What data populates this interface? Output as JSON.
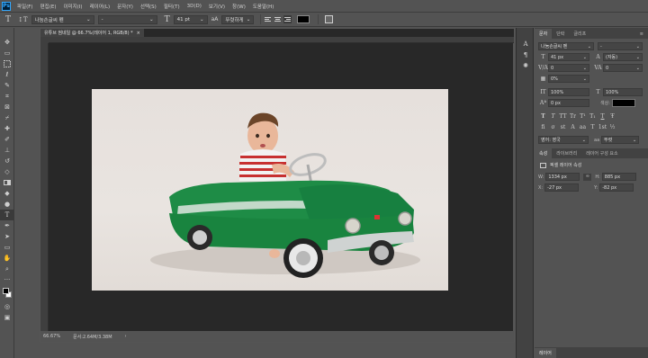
{
  "app": {
    "logo": "Ps"
  },
  "menu": [
    "파일(F)",
    "편집(E)",
    "이미지(I)",
    "레이어(L)",
    "문자(Y)",
    "선택(S)",
    "필터(T)",
    "3D(D)",
    "보기(V)",
    "창(W)",
    "도움말(H)"
  ],
  "options": {
    "font_family": "나눔손글씨 펜",
    "font_style": "-",
    "font_size": "41 pt",
    "aa_icon": "aA",
    "anti_alias": "뚜렷하게",
    "text_color": "#000000"
  },
  "document": {
    "tab_title": "유튜브 썸네일 @ 66.7%(레이어 1, RGB/8) *",
    "zoom": "66.67%",
    "doc_size": "문서:2.64M/3.38M"
  },
  "panel": {
    "tabs": [
      "문자",
      "단락",
      "글리프"
    ],
    "font_family": "나눔손글씨 펜",
    "font_style": "-",
    "font_size": "41 px",
    "leading": "(자동)",
    "kerning": "0",
    "tracking": "0",
    "tsume": "0%",
    "vscale": "100%",
    "hscale": "100%",
    "baseline": "0 px",
    "color_label": "색상:",
    "text_color": "#000000",
    "typo_buttons": [
      "T",
      "T",
      "TT",
      "Tr",
      "T¹",
      "T₁",
      "T",
      "Ŧ"
    ],
    "ot_buttons": [
      "fi",
      "σ",
      "st",
      "A",
      "aa",
      "T",
      "1st",
      "½"
    ],
    "language": "영어: 영국",
    "aa_label": "aa",
    "anti_alias": "뚜렷",
    "props_tabs": [
      "속성",
      "라이브러리",
      "레이어 구성 요소"
    ],
    "props_title": "픽셀 레이어 속성",
    "w_label": "W:",
    "w": "1334 px",
    "h_label": "H:",
    "h": "885 px",
    "x_label": "X:",
    "x": "-27 px",
    "y_label": "Y:",
    "y": "-82 px",
    "layers_tab": "레이어"
  },
  "colors": {
    "foreground": "#000000",
    "background": "#ffffff",
    "car_body": "#1e8c46"
  }
}
